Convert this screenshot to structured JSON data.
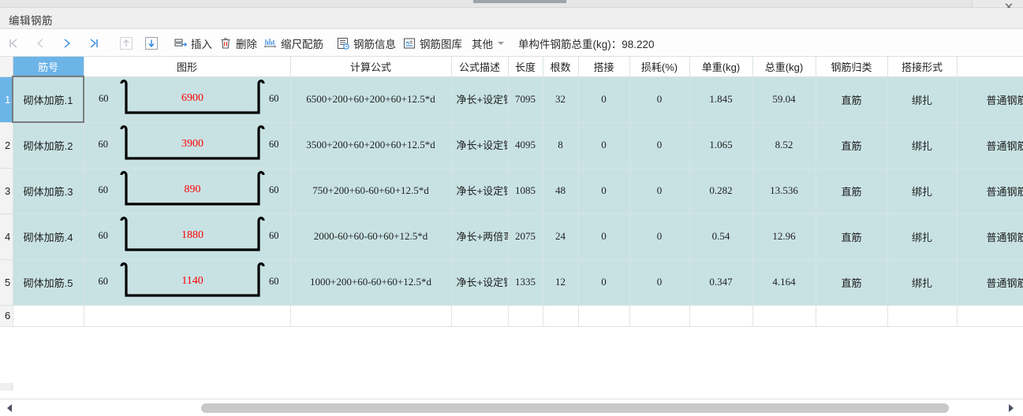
{
  "window": {
    "title": "编辑钢筋",
    "close_label": "✕"
  },
  "toolbar": {
    "nav_first": "first-record",
    "nav_prev": "previous-record",
    "nav_next": "next-record",
    "nav_last": "last-record",
    "move_up": "move-up",
    "move_down": "move-down",
    "insert_label": "插入",
    "delete_label": "删除",
    "scale_label": "缩尺配筋",
    "info_label": "钢筋信息",
    "library_label": "钢筋图库",
    "other_label": "其他",
    "total_label": "单构件钢筋总重(kg)：98.220"
  },
  "grid": {
    "columns": [
      "筋号",
      "图形",
      "计算公式",
      "公式描述",
      "长度",
      "根数",
      "搭接",
      "损耗(%)",
      "单重(kg)",
      "总重(kg)",
      "钢筋归类",
      "搭接形式",
      ""
    ],
    "selected_column_index": 0,
    "selected_row_index": 0,
    "rows": [
      {
        "num": "1",
        "name": "砌体加筋.1",
        "shape_dim_left": "60",
        "shape_dim_right": "60",
        "shape_len": "6900",
        "formula": "6500+200+60+200+60+12.5*d",
        "desc": "净长+设定锚固+…",
        "length": "7095",
        "count": "32",
        "lap": "0",
        "loss": "0",
        "unit_weight": "1.845",
        "total_weight": "59.04",
        "category": "直筋",
        "lap_type": "绑扎",
        "rebar_type": "普通钢筋"
      },
      {
        "num": "2",
        "name": "砌体加筋.2",
        "shape_dim_left": "60",
        "shape_dim_right": "60",
        "shape_len": "3900",
        "formula": "3500+200+60+200+60+12.5*d",
        "desc": "净长+设定锚固+…",
        "length": "4095",
        "count": "8",
        "lap": "0",
        "loss": "0",
        "unit_weight": "1.065",
        "total_weight": "8.52",
        "category": "直筋",
        "lap_type": "绑扎",
        "rebar_type": "普通钢筋"
      },
      {
        "num": "3",
        "name": "砌体加筋.3",
        "shape_dim_left": "60",
        "shape_dim_right": "60",
        "shape_len": "890",
        "formula": "750+200+60-60+60+12.5*d",
        "desc": "净长+设定锚固+…",
        "length": "1085",
        "count": "48",
        "lap": "0",
        "loss": "0",
        "unit_weight": "0.282",
        "total_weight": "13.536",
        "category": "直筋",
        "lap_type": "绑扎",
        "rebar_type": "普通钢筋"
      },
      {
        "num": "4",
        "name": "砌体加筋.4",
        "shape_dim_left": "60",
        "shape_dim_right": "60",
        "shape_len": "1880",
        "formula": "2000-60+60-60+60+12.5*d",
        "desc": "净长+两倍弯钩",
        "length": "2075",
        "count": "24",
        "lap": "0",
        "loss": "0",
        "unit_weight": "0.54",
        "total_weight": "12.96",
        "category": "直筋",
        "lap_type": "绑扎",
        "rebar_type": "普通钢筋"
      },
      {
        "num": "5",
        "name": "砌体加筋.5",
        "shape_dim_left": "60",
        "shape_dim_right": "60",
        "shape_len": "1140",
        "formula": "1000+200+60-60+60+12.5*d",
        "desc": "净长+设定锚固+…",
        "length": "1335",
        "count": "12",
        "lap": "0",
        "loss": "0",
        "unit_weight": "0.347",
        "total_weight": "4.164",
        "category": "直筋",
        "lap_type": "绑扎",
        "rebar_type": "普通钢筋"
      }
    ],
    "empty_row_num": "6"
  },
  "colors": {
    "row_fill": "#c8e2e4",
    "header_selected": "#6cb4e8",
    "dimension_text": "#ff0000"
  }
}
